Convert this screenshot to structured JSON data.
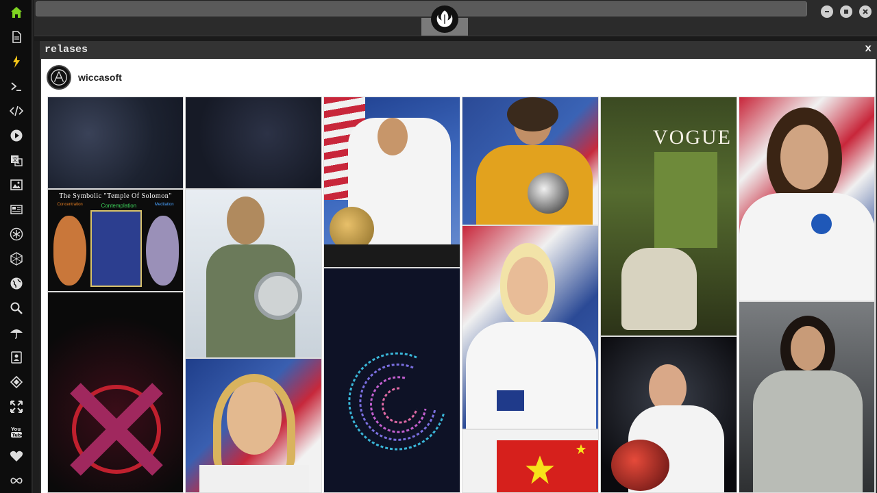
{
  "window": {
    "title": "relases",
    "close_label": "x"
  },
  "profile": {
    "name": "wiccasoft"
  },
  "dock": {
    "icons": [
      "home-icon",
      "document-icon",
      "bolt-icon",
      "terminal-icon",
      "code-icon",
      "play-icon",
      "translate-icon",
      "image-icon",
      "news-icon",
      "atom-icon",
      "hexagon-icon",
      "globe-icon",
      "search-icon",
      "umbrella-icon",
      "contacts-icon",
      "diamond-icon",
      "expand-icon",
      "youtube-icon",
      "heart-icon",
      "infinity-icon"
    ],
    "accent": "#7ed321",
    "bolt": "#f5c518"
  },
  "gallery": {
    "temple_title": "The Symbolic \"Temple Of Solomon\"",
    "temple_left": "Concentration",
    "temple_mid": "Contemplation",
    "temple_right": "Meditation",
    "vogue": "VOGUE"
  }
}
